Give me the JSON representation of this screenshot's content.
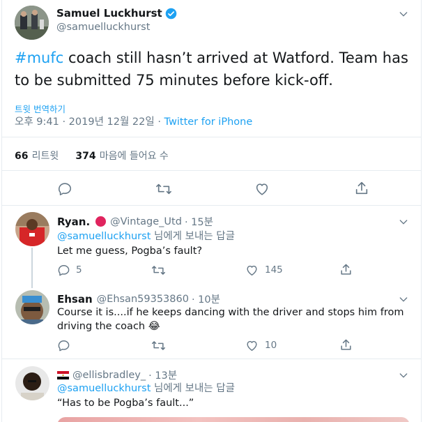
{
  "main_tweet": {
    "author_name": "Samuel Luckhurst",
    "author_handle": "@samuelluckhurst",
    "hashtag": "#mufc",
    "text_line1": " coach still hasn’t arrived at Watford. Team has",
    "text_line2": "to be submitted 75 minutes before kick-off.",
    "translate_label": "트윗 번역하기",
    "timestamp": "오후 9:41 · 2019년 12월 22일 · ",
    "client": "Twitter for iPhone",
    "retweet_count": "66",
    "retweet_label": "리트윗",
    "like_count": "374",
    "like_label": "마음에 들어요 수"
  },
  "replies": [
    {
      "name": "Ryan.",
      "handle": "@Vintage_Utd",
      "time": "· 15분",
      "replying_to": "@samuelluckhurst",
      "replying_suffix": " 님에게 보내는 답글",
      "text_line1": "Let me guess, Pogba’s fault?",
      "text_line2": "",
      "reply_count": "5",
      "like_count": "145"
    },
    {
      "name": "Ehsan",
      "handle": "@Ehsan59353860",
      "time": "· 10분",
      "text_line1": "Course it is....if he keeps dancing with the driver and stops him from",
      "text_line2": "driving the coach",
      "emoji": "😂",
      "like_count": "10"
    },
    {
      "name": "",
      "handle": "@ellisbradley_",
      "time": "· 13분",
      "replying_to": "@samuelluckhurst",
      "replying_suffix": " 님에게 보내는 답글",
      "text_line1": "“Has to be Pogba’s fault...”"
    }
  ],
  "colors": {
    "accent": "#1da1f2",
    "muted": "#657786",
    "divider": "#e6ecf0",
    "verified": "#1da1f2",
    "ryan_badge": "#e0245e"
  },
  "icons": [
    "verified-icon",
    "chevron-down-icon",
    "reply-icon",
    "retweet-icon",
    "like-icon",
    "share-icon",
    "egypt-flag-icon"
  ]
}
